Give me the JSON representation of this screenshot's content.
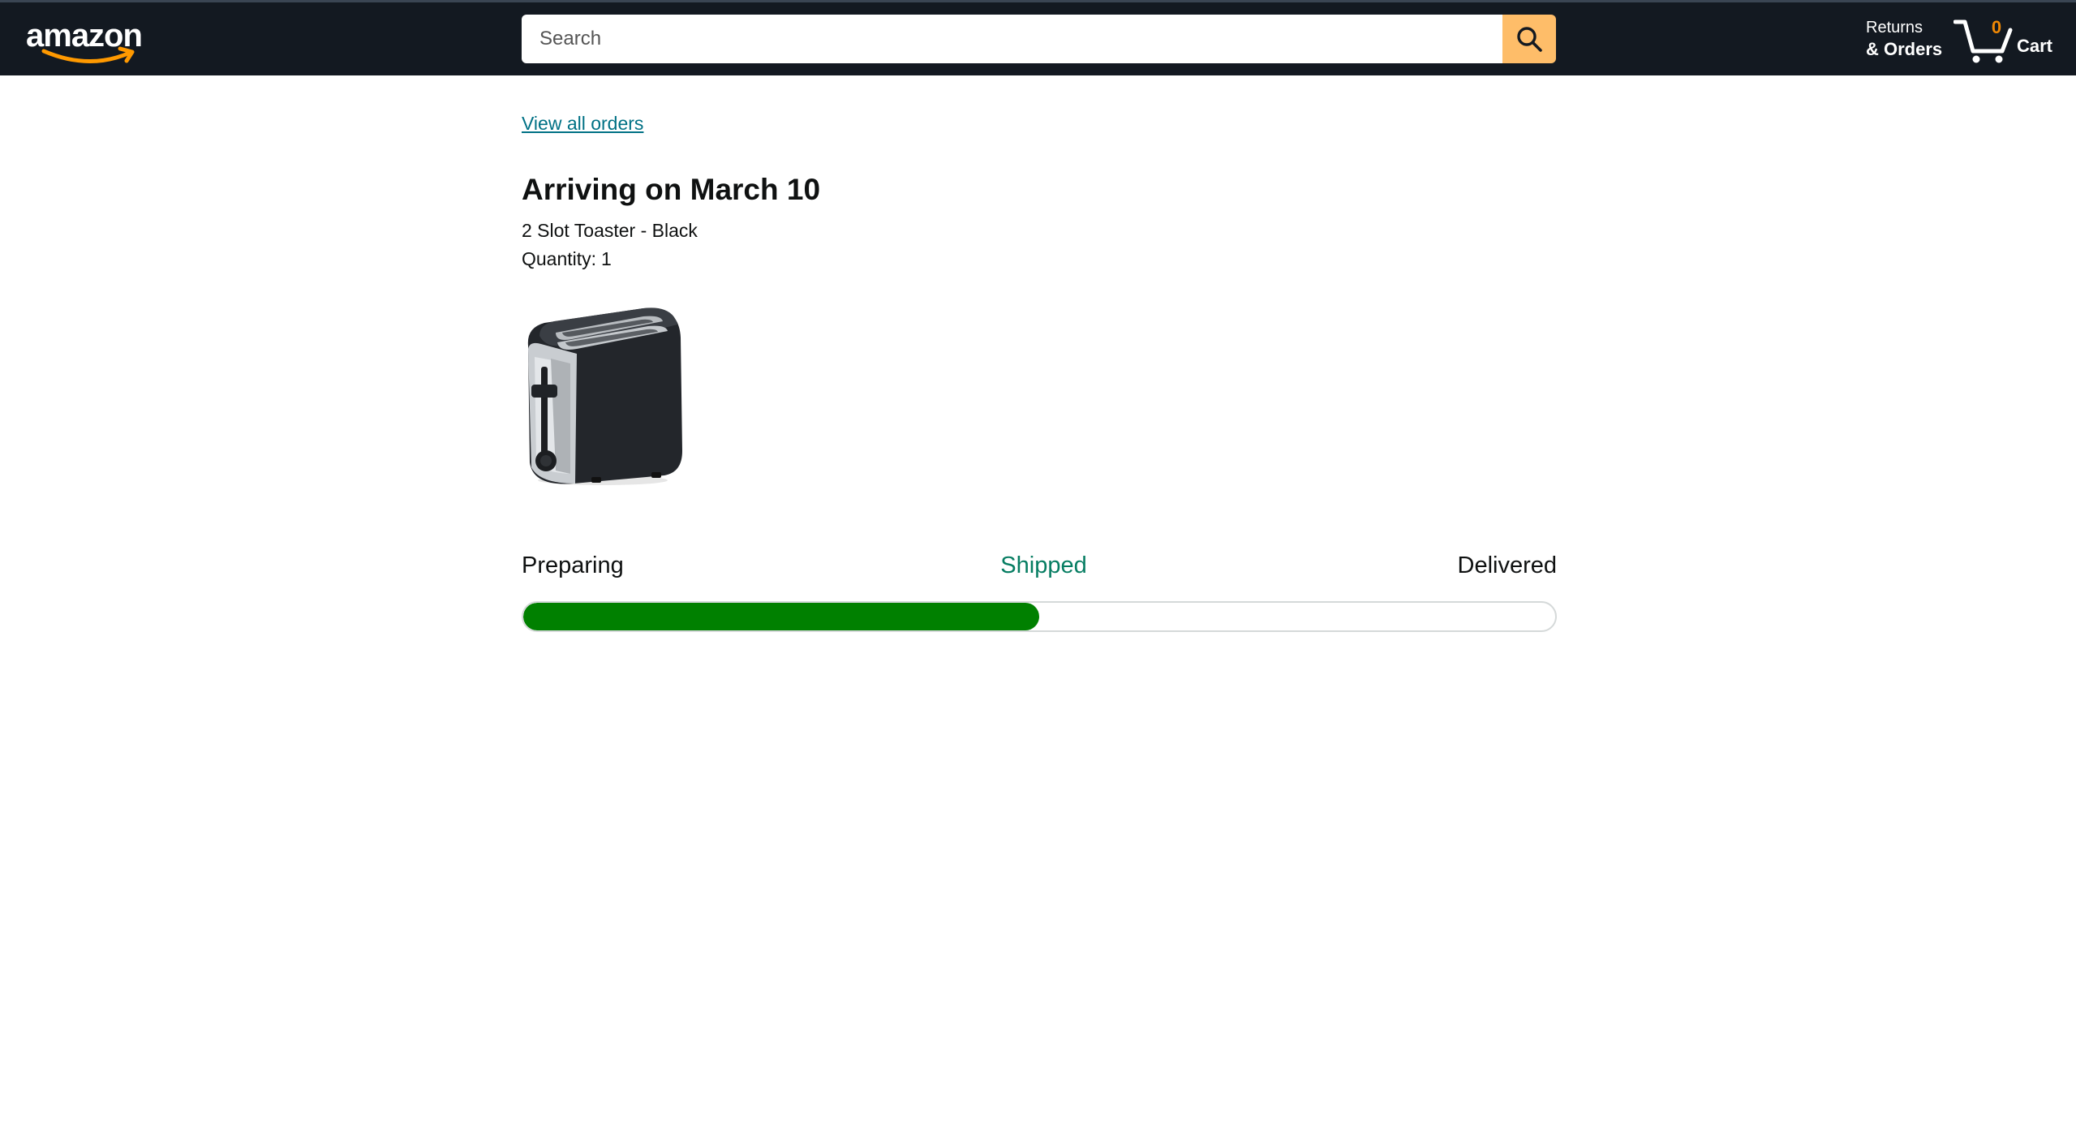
{
  "header": {
    "logo_text": "amazon",
    "search": {
      "placeholder": "Search",
      "value": ""
    },
    "returns": {
      "line1": "Returns",
      "line2": "& Orders"
    },
    "cart": {
      "count": "0",
      "label": "Cart"
    }
  },
  "order": {
    "view_all_link": "View all orders",
    "arrival_text": "Arriving on March 10",
    "product_name": "2 Slot Toaster - Black",
    "quantity_label": "Quantity:",
    "quantity_value": "1",
    "image_alt": "2 Slot Toaster - Black"
  },
  "progress": {
    "steps": [
      "Preparing",
      "Shipped",
      "Delivered"
    ],
    "current_step": "Shipped",
    "fill_fraction": 0.5
  },
  "colors": {
    "header_bg": "#131921",
    "search_button": "#febd69",
    "cart_count": "#f08804",
    "link": "#007185",
    "current_step": "#067d62",
    "progress_fill": "#008000"
  },
  "icons": {
    "logo_smile": "amazon-smile-arrow",
    "search": "magnifier",
    "cart": "shopping-cart"
  }
}
